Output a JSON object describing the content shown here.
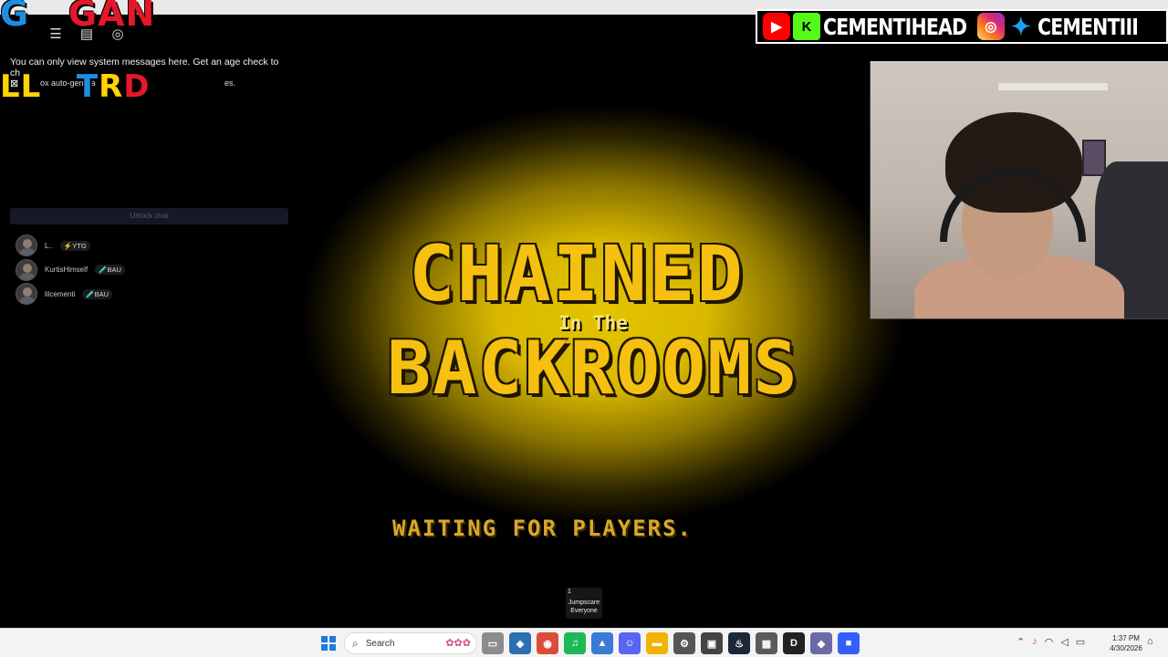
{
  "overlay": {
    "logo_top": [
      {
        "text": "G",
        "color": "blue"
      },
      {
        "text": " ",
        "color": "blue"
      },
      {
        "text": "GAN",
        "color": "red"
      }
    ],
    "logo_bottom": [
      {
        "text": "LL",
        "color": "yellow"
      },
      {
        "text": " ",
        "color": "yellow"
      },
      {
        "text": "T",
        "color": "blue"
      },
      {
        "text": "R",
        "color": "yellow"
      },
      {
        "text": "D",
        "color": "red"
      },
      {
        "text": "",
        "color": "green"
      }
    ],
    "social_handles": {
      "youtube_kick_name": "CEMENTIHEAD",
      "instagram_twitter_name": "CEMENTIII"
    },
    "social_colors": {
      "youtube": "#ff0000",
      "kick": "#53fc18",
      "twitter": "#1da1f2"
    }
  },
  "roblox": {
    "icons": [
      "menu-icon",
      "chat-icon",
      "headset-icon"
    ],
    "system_message": "You can only view system messages here. Get an age check to ch",
    "system_message_line2_left": "ox auto-genera",
    "system_message_line2_right": "es.",
    "close_symbol": "⊠",
    "unlock_chat_label": "Unlock chat",
    "players": [
      {
        "name": "L..",
        "badge": "⚡YTG"
      },
      {
        "name": "KurtisHimself",
        "badge": "🧪BAU"
      },
      {
        "name": "lilcementi",
        "badge": "🧪BAU"
      }
    ]
  },
  "game": {
    "title_line1": "CHAINED",
    "title_line2": "In The",
    "title_line3": "BACKROOMS",
    "title_color": "#f5c010",
    "status": "WAITING FOR PLAYERS.",
    "jumpscare": {
      "count": "1",
      "label_line1": "Jumpscare",
      "label_line2": "Everyone"
    }
  },
  "taskbar": {
    "search_placeholder": "Search",
    "apps": [
      {
        "icon": "file-explorer-icon",
        "color": "#8c8c8c",
        "glyph": "▭"
      },
      {
        "icon": "app-icon",
        "color": "#2a6fb0",
        "glyph": "◈"
      },
      {
        "icon": "chrome-icon",
        "color": "#dd4b39",
        "glyph": "◉"
      },
      {
        "icon": "spotify-icon",
        "color": "#1db954",
        "glyph": "♫"
      },
      {
        "icon": "photos-icon",
        "color": "#3a7bd5",
        "glyph": "▲"
      },
      {
        "icon": "discord-icon",
        "color": "#5865f2",
        "glyph": "☺"
      },
      {
        "icon": "folder-icon",
        "color": "#f0b400",
        "glyph": "▬"
      },
      {
        "icon": "settings-icon",
        "color": "#555555",
        "glyph": "⚙"
      },
      {
        "icon": "media-icon",
        "color": "#444444",
        "glyph": "▣"
      },
      {
        "icon": "steam-icon",
        "color": "#1b2838",
        "glyph": "♨"
      },
      {
        "icon": "calculator-icon",
        "color": "#5a5a5a",
        "glyph": "▦"
      },
      {
        "icon": "davinci-icon",
        "color": "#222222",
        "glyph": "D"
      },
      {
        "icon": "app-diamond-icon",
        "color": "#6a6aa8",
        "glyph": "◆"
      },
      {
        "icon": "roblox-icon",
        "color": "#335fff",
        "glyph": "■"
      }
    ],
    "tray_icons": [
      "chevron-up-icon",
      "microphone-icon",
      "wifi-icon",
      "volume-icon",
      "battery-icon"
    ],
    "time": "1:37 PM",
    "date": "4/30/2026"
  }
}
